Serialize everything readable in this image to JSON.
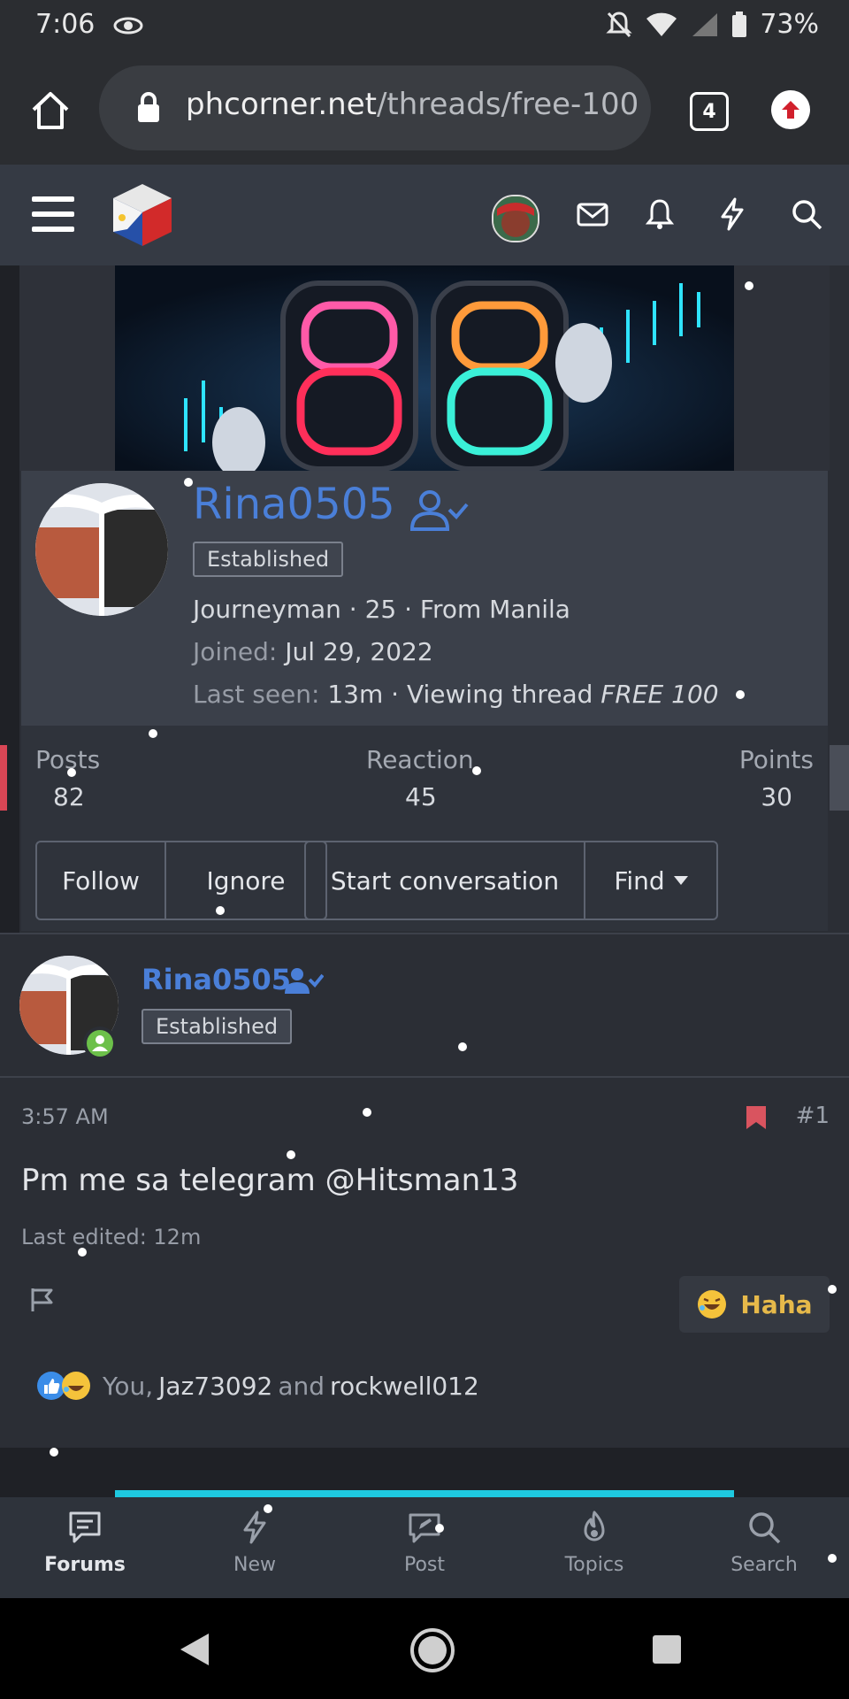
{
  "status_bar": {
    "time": "7:06",
    "battery": "73%"
  },
  "browser": {
    "url_domain": "phcorner.net",
    "url_path": "/threads/free-100",
    "tab_count": "4"
  },
  "member_card": {
    "username": "Rina0505",
    "badge": "Established",
    "info_line": "Journeyman · 25 · From Manila",
    "joined_label": "Joined:",
    "joined_value": "Jul 29, 2022",
    "last_seen_label": "Last seen:",
    "last_seen_value": "13m · Viewing thread",
    "last_seen_thread": "FREE 100",
    "stats": [
      {
        "label": "Posts",
        "value": "82"
      },
      {
        "label": "Reaction",
        "value": "45"
      },
      {
        "label": "Points",
        "value": "30"
      }
    ],
    "buttons": {
      "follow": "Follow",
      "ignore": "Ignore",
      "start_conversation": "Start conversation",
      "find": "Find"
    }
  },
  "post": {
    "author": "Rina0505",
    "badge": "Established",
    "time": "3:57 AM",
    "number": "#1",
    "text": "Pm me sa telegram @Hitsman13",
    "edited": "Last edited: 12m",
    "reaction_button": "Haha",
    "reactions": {
      "you": "You,",
      "user1": "Jaz73092",
      "and": "and",
      "user2": "rockwell012"
    }
  },
  "bottom_nav": [
    {
      "label": "Forums"
    },
    {
      "label": "New"
    },
    {
      "label": "Post"
    },
    {
      "label": "Topics"
    },
    {
      "label": "Search"
    }
  ],
  "colors": {
    "accent": "#4a7fd8",
    "haha": "#e6b94a",
    "online": "#6cc04a",
    "bookmark": "#d9545f"
  }
}
